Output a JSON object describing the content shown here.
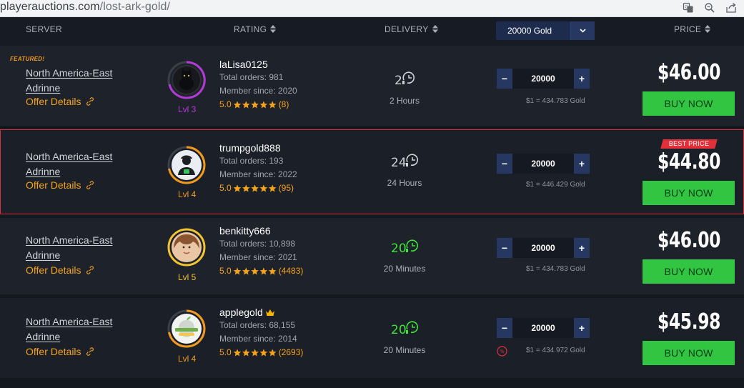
{
  "browser": {
    "url_host": "playerauctions.com",
    "url_path": "/lost-ark-gold/"
  },
  "header": {
    "server": "SERVER",
    "rating": "RATING",
    "delivery": "DELIVERY",
    "gold_select": "20000 Gold",
    "price": "PRICE"
  },
  "colors": {
    "accent_orange": "#f6a21b",
    "buy_green": "#31c541",
    "stepper_blue": "#263761",
    "best_red": "#e0313b",
    "highlight_border": "#d9303a"
  },
  "offers": [
    {
      "featured": "FEATURED!",
      "server": "North America-East",
      "realm": "Adrinne",
      "offer_details": "Offer Details",
      "seller": "laLisa0125",
      "orders": "Total orders: 981",
      "member": "Member since: 2020",
      "score": "5.0",
      "reviews": "(8)",
      "level": "Lvl 3",
      "level_color": "#b43ad8",
      "delivery_icon_num": "2",
      "delivery": "2 Hours",
      "quantity": "20000",
      "rate": "$1 = 434.783 Gold",
      "price": "$46.00",
      "buy": "BUY NOW"
    },
    {
      "server": "North America-East",
      "realm": "Adrinne",
      "offer_details": "Offer Details",
      "seller": "trumpgold888",
      "orders": "Total orders: 193",
      "member": "Member since: 2022",
      "score": "5.0",
      "reviews": "(95)",
      "level": "Lvl 4",
      "level_color": "#f39a1e",
      "badge": "BEST PRICE",
      "delivery_icon_num": "24",
      "delivery": "24 Hours",
      "quantity": "20000",
      "rate": "$1 = 446.429 Gold",
      "price": "$44.80",
      "buy": "BUY NOW"
    },
    {
      "server": "North America-East",
      "realm": "Adrinne",
      "offer_details": "Offer Details",
      "seller": "benkitty666",
      "orders": "Total orders: 10,898",
      "member": "Member since: 2021",
      "score": "5.0",
      "reviews": "(4483)",
      "level": "Lvl 5",
      "level_color": "#f4c430",
      "delivery_icon_num": "20",
      "delivery": "20 Minutes",
      "quantity": "20000",
      "rate": "$1 = 434.783 Gold",
      "price": "$46.00",
      "buy": "BUY NOW"
    },
    {
      "server": "North America-East",
      "realm": "Adrinne",
      "offer_details": "Offer Details",
      "seller": "applegold",
      "orders": "Total orders: 68,155",
      "member": "Member since: 2014",
      "score": "5.0",
      "reviews": "(2693)",
      "level": "Lvl 4",
      "level_color": "#f39a1e",
      "delivery_icon_num": "20",
      "delivery": "20 Minutes",
      "quantity": "20000",
      "rate": "$1 = 434.972 Gold",
      "price": "$45.98",
      "buy": "BUY NOW"
    }
  ]
}
